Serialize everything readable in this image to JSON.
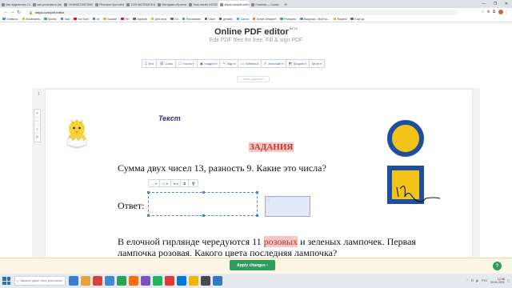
{
  "browser": {
    "tabs": [
      {
        "title": "Как подключить Соглашение",
        "active": false
      },
      {
        "title": "как установить (переорди...",
        "active": false
      },
      {
        "title": "+4099657285789674201...",
        "active": false
      },
      {
        "title": "Реклама Spot vebena 2112...",
        "active": false
      },
      {
        "title": "1105 MATEMATIKA_lEb_pdf",
        "active": false
      },
      {
        "title": "Методика обучения матем...",
        "active": false
      },
      {
        "title": "Task results NZXSS1GQ 201...",
        "active": false
      },
      {
        "title": "sejda.com/pdf-editor",
        "active": true
      },
      {
        "title": "Главная — Canva",
        "active": false
      }
    ],
    "new_tab": "+",
    "window_controls": [
      "—",
      "❐",
      "✕"
    ],
    "url": "sejda.com/pdf-editor",
    "bookmarks": [
      {
        "label": "Сервисы",
        "color": "#4285f4"
      },
      {
        "label": "Bookmarks",
        "color": "#f4b400"
      },
      {
        "label": "Spotify",
        "color": "#1db954"
      },
      {
        "label": "mail",
        "color": "#168de2"
      },
      {
        "label": "YouTube",
        "color": "#ff0000"
      },
      {
        "label": "vk",
        "color": "#4a76a8"
      },
      {
        "label": "Scratch",
        "color": "#f9a825"
      },
      {
        "label": "Pin",
        "color": "#e60023"
      },
      {
        "label": "Applcati",
        "color": "#5f6368"
      },
      {
        "label": "Для игра",
        "color": "#f4b400"
      },
      {
        "label": "Ou",
        "color": "#5f6368"
      },
      {
        "label": "Рисование",
        "color": "#34a853"
      },
      {
        "label": "Свое",
        "color": "#5f6368"
      },
      {
        "label": "genially",
        "color": "#2f4ed1"
      },
      {
        "label": "Canva",
        "color": "#00c4cc"
      },
      {
        "label": "Gravit Designer",
        "color": "#ff6d00"
      },
      {
        "label": "Photopea",
        "color": "#18a497"
      },
      {
        "label": "Выручка - Мой на...",
        "color": "#4285f4"
      },
      {
        "label": "Klipartz",
        "color": "#f4b400"
      },
      {
        "label": "Ещё до",
        "color": "#5f6368"
      }
    ]
  },
  "header": {
    "title": "Online PDF editor",
    "badge": "BETA",
    "subtitle": "Edit PDF files for free. Fill & sign PDF"
  },
  "toolbar": {
    "items": [
      {
        "label": "Text",
        "icon": "text-cursor-icon",
        "glyph": "Ɪ",
        "dropdown": false
      },
      {
        "label": "Links",
        "icon": "link-icon",
        "glyph": "⛓",
        "dropdown": false
      },
      {
        "label": "Forms",
        "icon": "form-icon",
        "glyph": "☐",
        "dropdown": true
      },
      {
        "label": "Images",
        "icon": "image-icon",
        "glyph": "▣",
        "dropdown": true
      },
      {
        "label": "Sign",
        "icon": "pen-icon",
        "glyph": "✎",
        "dropdown": true
      },
      {
        "label": "Whiteout",
        "icon": "eraser-icon",
        "glyph": "▭",
        "dropdown": false
      },
      {
        "label": "Annotate",
        "icon": "annotate-icon",
        "glyph": "✐",
        "dropdown": true
      },
      {
        "label": "Shapes",
        "icon": "shapes-icon",
        "glyph": "◩",
        "dropdown": true
      },
      {
        "label": "More",
        "icon": "more-icon",
        "glyph": "",
        "dropdown": true
      }
    ],
    "insert_page": "Insert page here"
  },
  "document": {
    "page_number": "1",
    "side_tools": [
      {
        "icon": "zoom-in-icon",
        "glyph": "+"
      },
      {
        "icon": "zoom-out-icon",
        "glyph": "−"
      },
      {
        "icon": "search-icon",
        "glyph": "⌕"
      },
      {
        "icon": "rotate-icon",
        "glyph": "⟳"
      }
    ],
    "text_label": "Текст",
    "task_heading": "ЗАДАНИЯ",
    "problem1": "Сумма двух чисел 13, разность 9. Какие это числа?",
    "answer_label": "Ответ:",
    "mini_toolbar": [
      "↔ ▾",
      "☐ ▾",
      "● ▾",
      "⧉",
      "🗑"
    ],
    "problem2_before": "В елочной гирлянде чередуются 11 ",
    "problem2_highlight": "розовых",
    "problem2_after": " и зеленых лампочек. Первая лампочка розовая. Какого цвета последняя лампочка?"
  },
  "footer": {
    "apply_label": "Apply changes",
    "apply_chevron": "›",
    "help_label": "?"
  },
  "taskbar": {
    "search_placeholder": "Введите здесь текст для поиска",
    "apps": [
      "#3a7bd5",
      "#e8a33b",
      "#d9453b",
      "#3d8bd8",
      "#2aa44f",
      "#ff6d00",
      "#7b53c1",
      "#1db954",
      "#e53935",
      "#0078d7",
      "#f4b400",
      "#4a4a4a",
      "#3778c2"
    ],
    "tray_lang": "РУС",
    "time": "12:48",
    "date": "20.01.2021"
  },
  "colors": {
    "accent": "#2e9e5e",
    "toolbar_text": "#3b6b8c",
    "highlight_bg": "#f6c7c4",
    "highlight_text": "#c0392b",
    "field_border": "#4a86c8",
    "shape_circle": "#1f4e9e",
    "shape_fill": "#f2c418"
  }
}
